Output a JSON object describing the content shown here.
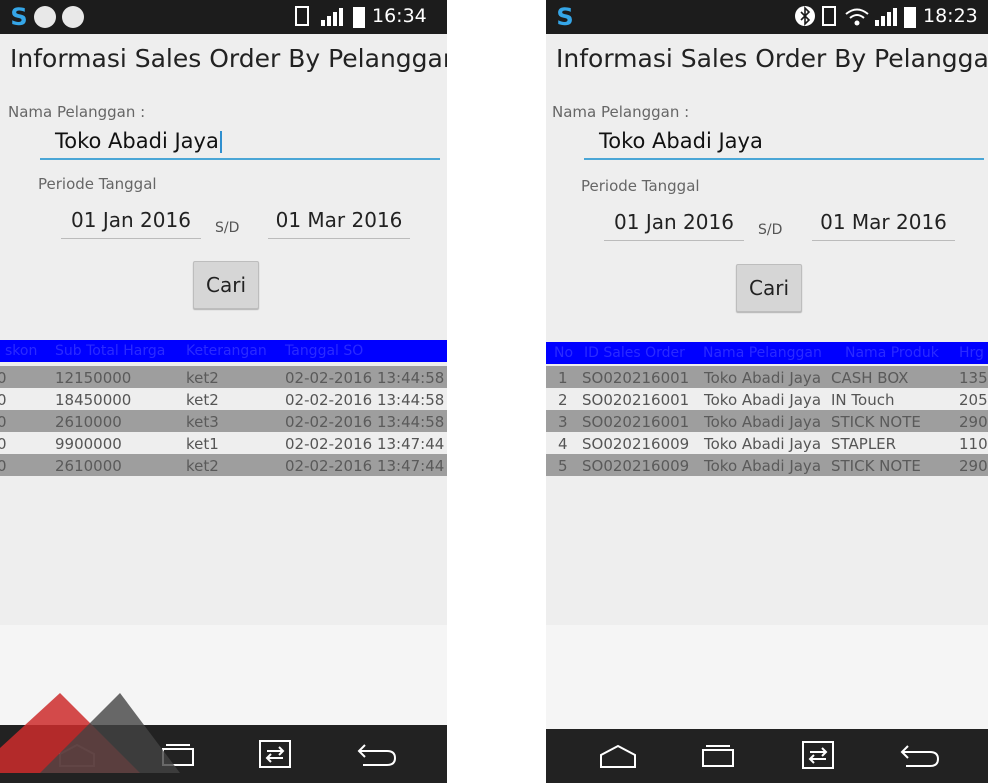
{
  "left": {
    "status_time": "16:34",
    "title": "Informasi Sales Order By Pelanggan",
    "customer_label": "Nama Pelanggan :",
    "customer_value": "Toko Abadi Jaya",
    "period_label": "Periode Tanggal",
    "date_from": "01 Jan 2016",
    "separator": "S/D",
    "date_to": "01 Mar 2016",
    "search_button": "Cari",
    "columns": [
      "skon",
      "Sub Total Harga",
      "Keterangan",
      "Tanggal SO"
    ],
    "rows": [
      {
        "discount": "0",
        "subtotal": "12150000",
        "note": "ket2",
        "date": "02-02-2016 13:44:58"
      },
      {
        "discount": "0",
        "subtotal": "18450000",
        "note": "ket2",
        "date": "02-02-2016 13:44:58"
      },
      {
        "discount": "0",
        "subtotal": "2610000",
        "note": "ket3",
        "date": "02-02-2016 13:44:58"
      },
      {
        "discount": "0",
        "subtotal": "9900000",
        "note": "ket1",
        "date": "02-02-2016 13:47:44"
      },
      {
        "discount": "0",
        "subtotal": "2610000",
        "note": "ket2",
        "date": "02-02-2016 13:47:44"
      }
    ]
  },
  "right": {
    "status_time": "18:23",
    "title": "Informasi Sales Order By Pelanggan",
    "customer_label": "Nama Pelanggan :",
    "customer_value": "Toko Abadi Jaya",
    "period_label": "Periode Tanggal",
    "date_from": "01 Jan 2016",
    "separator": "S/D",
    "date_to": "01 Mar 2016",
    "search_button": "Cari",
    "columns": [
      "No",
      "ID Sales Order",
      "Nama Pelanggan",
      "Nama Produk",
      "Hrg"
    ],
    "rows": [
      {
        "no": "1",
        "id": "SO020216001",
        "customer": "Toko Abadi Jaya",
        "product": "CASH BOX",
        "price": "135"
      },
      {
        "no": "2",
        "id": "SO020216001",
        "customer": "Toko Abadi Jaya",
        "product": "IN Touch",
        "price": "205"
      },
      {
        "no": "3",
        "id": "SO020216001",
        "customer": "Toko Abadi Jaya",
        "product": "STICK NOTE",
        "price": "290"
      },
      {
        "no": "4",
        "id": "SO020216009",
        "customer": "Toko Abadi Jaya",
        "product": "STAPLER",
        "price": "110"
      },
      {
        "no": "5",
        "id": "SO020216009",
        "customer": "Toko Abadi Jaya",
        "product": "STICK NOTE",
        "price": "290"
      }
    ]
  },
  "colors": {
    "header_blue": "#0000ff",
    "input_underline": "#4aa6d6",
    "status_bar": "#1c1c1c",
    "nav_bar": "#222222",
    "gray_row": "#9e9e9e"
  },
  "icons": {
    "status_left": [
      "app-s-icon",
      "app-circle-icon",
      "app-circle-icon",
      "phone-icon",
      "signal-icon",
      "battery-icon"
    ],
    "status_right": [
      "app-s-icon",
      "bluetooth-icon",
      "phone-icon",
      "wifi-icon",
      "signal-icon",
      "battery-icon"
    ],
    "nav": [
      "home-icon",
      "recent-apps-icon",
      "dual-window-icon",
      "back-icon"
    ]
  }
}
